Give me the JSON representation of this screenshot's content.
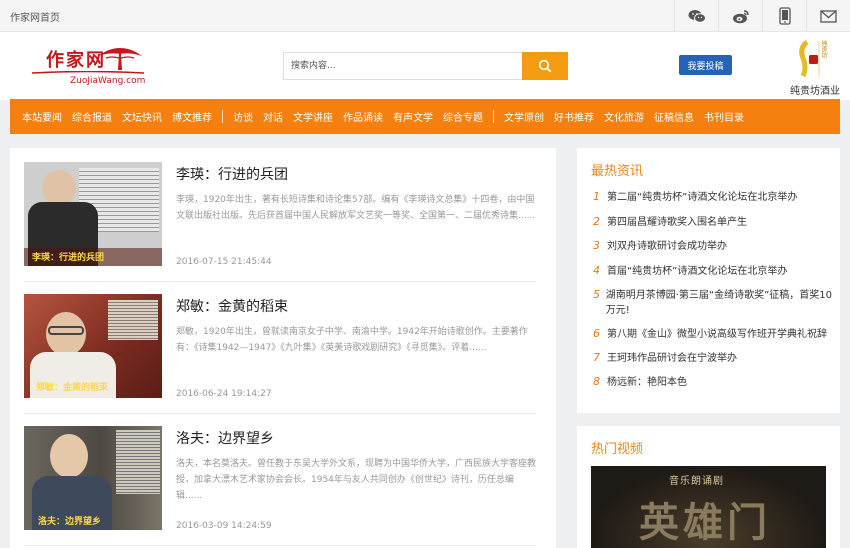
{
  "topbar": {
    "home": "作家网首页",
    "icons": [
      "wechat-icon",
      "weibo-icon",
      "mobile-icon",
      "mail-icon"
    ]
  },
  "header": {
    "logo_cn": "作家网",
    "logo_en": "ZuoJiaWang.com",
    "search_placeholder": "搜索内容...",
    "submit_label": "我要投稿",
    "brand_mark": "纯贵坊",
    "brand_name": "纯贵坊酒业"
  },
  "nav": {
    "group1": [
      "本站要闻",
      "综合报道",
      "文坛快讯",
      "博文推荐"
    ],
    "group2": [
      "访谈",
      "对话",
      "文学讲座",
      "作品诵读",
      "有声文学",
      "综合专题"
    ],
    "group3": [
      "文学原创",
      "好书推荐",
      "文化旅游",
      "征稿信息",
      "书刊目录"
    ]
  },
  "articles": [
    {
      "title": "李瑛：行进的兵团",
      "summary": "李瑛，1920年出生，著有长短诗集和诗论集57部。编有《李瑛诗文总集》十四卷，由中国文联出版社出版。先后获首届中国人民解放军文艺奖一等奖、全国第一、二届优秀诗集......",
      "date": "2016-07-15 21:45:44",
      "caption": "李瑛：行进的兵团"
    },
    {
      "title": "郑敏：金黄的稻束",
      "summary": "郑敏，1920年出生，曾就读南京女子中学、南渝中学。1942年开始诗歌创作。主要著作有：《诗集1942—1947》《九叶集》《英美诗歌戏剧研究》《寻觅集》。评着......",
      "date": "2016-06-24 19:14:27",
      "caption": "郑敏：金黄的稻束"
    },
    {
      "title": "洛夫：边界望乡",
      "summary": "洛夫，本名莫洛夫。曾任教于东吴大学外文系，现聘为中国华侨大学，广西民族大学客座教授，加拿大漂木艺术家协会会长。1954年与友人共同创办《创世纪》诗刊，历任总编辑......",
      "date": "2016-03-09 14:24:59",
      "caption": "洛夫：边界望乡"
    }
  ],
  "hot_news": {
    "title": "最热资讯",
    "items": [
      {
        "n": "1",
        "text": "第二届“纯贵坊杯”诗酒文化论坛在北京举办"
      },
      {
        "n": "2",
        "text": "第四届昌耀诗歌奖入围名单产生"
      },
      {
        "n": "3",
        "text": "刘双舟诗歌研讨会成功举办"
      },
      {
        "n": "4",
        "text": "首届“纯贵坊杯”诗酒文化论坛在北京举办"
      },
      {
        "n": "5",
        "text": "湖南明月茶博园·第三届“金绮诗歌奖”征稿，首奖10万元!"
      },
      {
        "n": "6",
        "text": "第八期《金山》微型小说高级写作班开学典礼祝辞"
      },
      {
        "n": "7",
        "text": "王珂玮作品研讨会在宁波举办"
      },
      {
        "n": "8",
        "text": "杨远新：艳阳本色"
      }
    ]
  },
  "hot_video": {
    "title": "热门视频",
    "top_text": "音乐朗诵剧",
    "big_text": "英雄门"
  },
  "colors": {
    "nav": "#f5800f",
    "search_button": "#f39c12",
    "submit": "#2563b6",
    "logo": "#c8161d",
    "accent": "#f08519"
  }
}
